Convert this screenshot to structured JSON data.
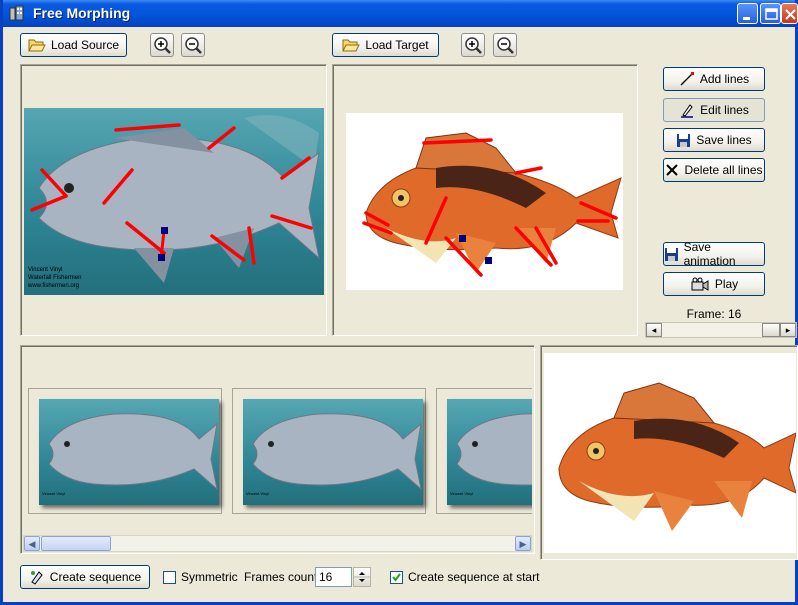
{
  "window": {
    "title": "Free Morphing"
  },
  "source_toolbar": {
    "load_label": "Load Source"
  },
  "target_toolbar": {
    "load_label": "Load Target"
  },
  "side": {
    "add_lines": "Add lines",
    "edit_lines": "Edit lines",
    "save_lines": "Save lines",
    "delete_lines": "Delete all lines",
    "save_animation": "Save animation",
    "play": "Play",
    "frame_label": "Frame: 16",
    "frame_slider_fraction": 1.0
  },
  "bottom": {
    "create_sequence": "Create sequence",
    "symmetric_label": "Symmetric",
    "symmetric_checked": false,
    "frames_count_label": "Frames count:",
    "frames_count_value": "16",
    "create_at_start_label": "Create sequence at start",
    "create_at_start_checked": true
  },
  "watermark_lines": [
    "Vincent Vinyl",
    "Waterfall Fishermen",
    "www.fishermen.org"
  ],
  "colors": {
    "titlebar": "#0355db",
    "morph_line": "#ff0000",
    "handle": "#00007f",
    "water": "#2f8595"
  }
}
